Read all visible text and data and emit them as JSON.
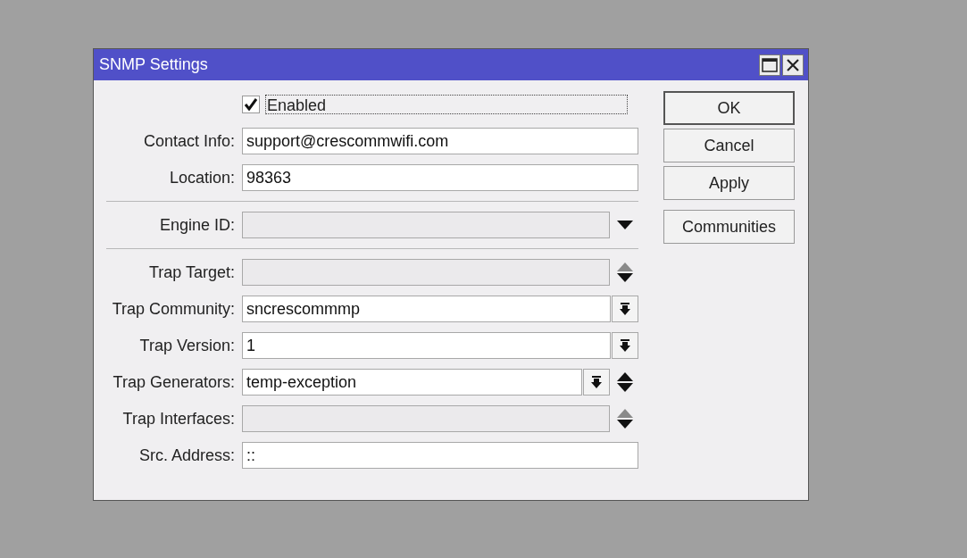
{
  "window": {
    "title": "SNMP Settings"
  },
  "enabled": {
    "label": "Enabled",
    "checked": true
  },
  "rows": [
    {
      "kind": "field",
      "label": "Contact Info:",
      "value": "support@crescommwifi.com",
      "disabled": false
    },
    {
      "kind": "field",
      "label": "Location:",
      "value": "98363",
      "disabled": false
    },
    {
      "kind": "separator"
    },
    {
      "kind": "field",
      "label": "Engine ID:",
      "disabled": true,
      "down_arrow": true
    },
    {
      "kind": "separator"
    },
    {
      "kind": "field",
      "label": "Trap Target:",
      "disabled": true,
      "down_arrow": true,
      "up_arrow": true,
      "up_arrow_disabled": true
    },
    {
      "kind": "field",
      "label": "Trap Community:",
      "value": "sncrescommmp",
      "disabled": false,
      "dropdown_button": true
    },
    {
      "kind": "field",
      "label": "Trap Version:",
      "value": "1",
      "disabled": false,
      "dropdown_button": true
    },
    {
      "kind": "field",
      "label": "Trap Generators:",
      "value": "temp-exception",
      "disabled": false,
      "dropdown_button": true,
      "down_arrow": true,
      "up_arrow": true,
      "up_arrow_disabled": false
    },
    {
      "kind": "field",
      "label": "Trap Interfaces:",
      "disabled": true,
      "down_arrow": true,
      "up_arrow": true,
      "up_arrow_disabled": true
    },
    {
      "kind": "field",
      "label": "Src. Address:",
      "value": "::",
      "disabled": false
    }
  ],
  "buttons": [
    {
      "label": "OK",
      "default": true
    },
    {
      "label": "Cancel",
      "default": false
    },
    {
      "label": "Apply",
      "default": false
    }
  ],
  "extra_buttons": [
    {
      "label": "Communities",
      "default": false
    }
  ]
}
